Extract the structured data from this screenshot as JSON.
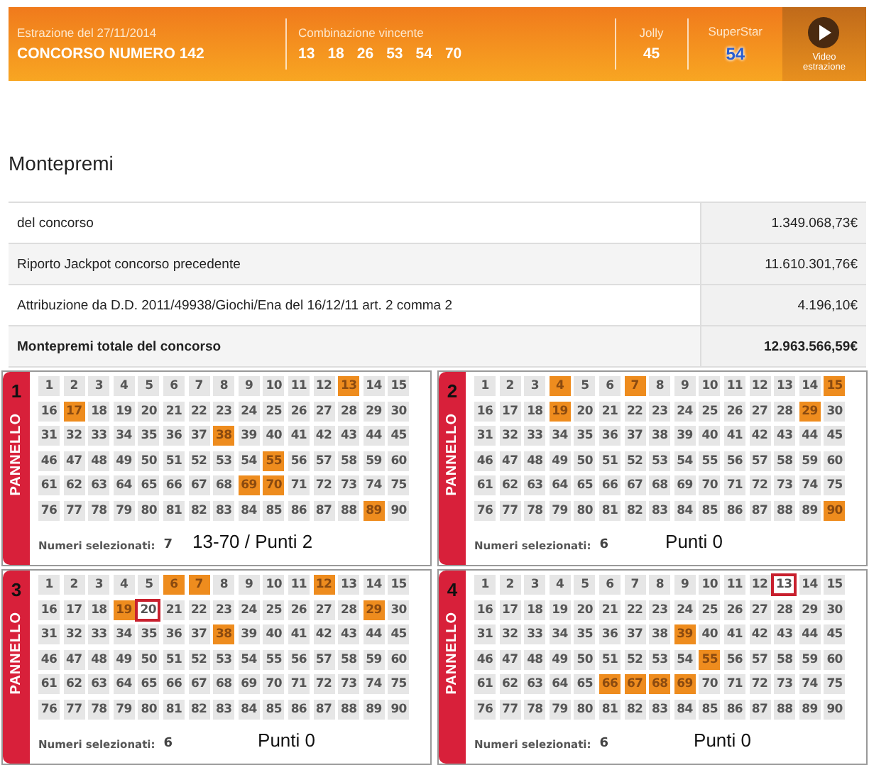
{
  "header": {
    "date_label": "Estrazione del 27/11/2014",
    "title": "CONCORSO NUMERO 142",
    "combination_label": "Combinazione vincente",
    "combination": [
      "13",
      "18",
      "26",
      "53",
      "54",
      "70"
    ],
    "jolly_label": "Jolly",
    "jolly": "45",
    "superstar_label": "SuperStar",
    "superstar": "54",
    "video_label": "Video estrazione"
  },
  "montepremi": {
    "title": "Montepremi",
    "rows": [
      {
        "label": "del concorso",
        "value": "1.349.068,73€",
        "kind": "normal"
      },
      {
        "label": "Riporto Jackpot concorso precedente",
        "value": "11.610.301,76€",
        "kind": "normal"
      },
      {
        "label": "Attribuzione da D.D. 2011/49938/Giochi/Ena del 16/12/11 art. 2 comma 2",
        "value": "4.196,10€",
        "kind": "normal"
      },
      {
        "label": "Montepremi totale del concorso",
        "value": "12.963.566,59€",
        "kind": "total"
      }
    ]
  },
  "panels": [
    {
      "number": "1",
      "label": "PANNELLO",
      "selected_label": "Numeri selezionati:",
      "selected_count": "7",
      "note": "13-70 / Punti 2",
      "cells": [
        {
          "n": "1",
          "kind": "plain"
        },
        {
          "n": "2",
          "kind": "plain"
        },
        {
          "n": "3",
          "kind": "plain"
        },
        {
          "n": "4",
          "kind": "plain"
        },
        {
          "n": "5",
          "kind": "plain"
        },
        {
          "n": "6",
          "kind": "plain"
        },
        {
          "n": "7",
          "kind": "plain"
        },
        {
          "n": "8",
          "kind": "plain"
        },
        {
          "n": "9",
          "kind": "plain"
        },
        {
          "n": "10",
          "kind": "plain"
        },
        {
          "n": "11",
          "kind": "plain"
        },
        {
          "n": "12",
          "kind": "plain"
        },
        {
          "n": "13",
          "kind": "hit"
        },
        {
          "n": "14",
          "kind": "plain"
        },
        {
          "n": "15",
          "kind": "plain"
        },
        {
          "n": "16",
          "kind": "plain"
        },
        {
          "n": "17",
          "kind": "hit"
        },
        {
          "n": "18",
          "kind": "plain"
        },
        {
          "n": "19",
          "kind": "plain"
        },
        {
          "n": "20",
          "kind": "plain"
        },
        {
          "n": "21",
          "kind": "plain"
        },
        {
          "n": "22",
          "kind": "plain"
        },
        {
          "n": "23",
          "kind": "plain"
        },
        {
          "n": "24",
          "kind": "plain"
        },
        {
          "n": "25",
          "kind": "plain"
        },
        {
          "n": "26",
          "kind": "plain"
        },
        {
          "n": "27",
          "kind": "plain"
        },
        {
          "n": "28",
          "kind": "plain"
        },
        {
          "n": "29",
          "kind": "plain"
        },
        {
          "n": "30",
          "kind": "plain"
        },
        {
          "n": "31",
          "kind": "plain"
        },
        {
          "n": "32",
          "kind": "plain"
        },
        {
          "n": "33",
          "kind": "plain"
        },
        {
          "n": "34",
          "kind": "plain"
        },
        {
          "n": "35",
          "kind": "plain"
        },
        {
          "n": "36",
          "kind": "plain"
        },
        {
          "n": "37",
          "kind": "plain"
        },
        {
          "n": "38",
          "kind": "hit"
        },
        {
          "n": "39",
          "kind": "plain"
        },
        {
          "n": "40",
          "kind": "plain"
        },
        {
          "n": "41",
          "kind": "plain"
        },
        {
          "n": "42",
          "kind": "plain"
        },
        {
          "n": "43",
          "kind": "plain"
        },
        {
          "n": "44",
          "kind": "plain"
        },
        {
          "n": "45",
          "kind": "plain"
        },
        {
          "n": "46",
          "kind": "plain"
        },
        {
          "n": "47",
          "kind": "plain"
        },
        {
          "n": "48",
          "kind": "plain"
        },
        {
          "n": "49",
          "kind": "plain"
        },
        {
          "n": "50",
          "kind": "plain"
        },
        {
          "n": "51",
          "kind": "plain"
        },
        {
          "n": "52",
          "kind": "plain"
        },
        {
          "n": "53",
          "kind": "plain"
        },
        {
          "n": "54",
          "kind": "plain"
        },
        {
          "n": "55",
          "kind": "hit"
        },
        {
          "n": "56",
          "kind": "plain"
        },
        {
          "n": "57",
          "kind": "plain"
        },
        {
          "n": "58",
          "kind": "plain"
        },
        {
          "n": "59",
          "kind": "plain"
        },
        {
          "n": "60",
          "kind": "plain"
        },
        {
          "n": "61",
          "kind": "plain"
        },
        {
          "n": "62",
          "kind": "plain"
        },
        {
          "n": "63",
          "kind": "plain"
        },
        {
          "n": "64",
          "kind": "plain"
        },
        {
          "n": "65",
          "kind": "plain"
        },
        {
          "n": "66",
          "kind": "plain"
        },
        {
          "n": "67",
          "kind": "plain"
        },
        {
          "n": "68",
          "kind": "plain"
        },
        {
          "n": "69",
          "kind": "hit"
        },
        {
          "n": "70",
          "kind": "hit"
        },
        {
          "n": "71",
          "kind": "plain"
        },
        {
          "n": "72",
          "kind": "plain"
        },
        {
          "n": "73",
          "kind": "plain"
        },
        {
          "n": "74",
          "kind": "plain"
        },
        {
          "n": "75",
          "kind": "plain"
        },
        {
          "n": "76",
          "kind": "plain"
        },
        {
          "n": "77",
          "kind": "plain"
        },
        {
          "n": "78",
          "kind": "plain"
        },
        {
          "n": "79",
          "kind": "plain"
        },
        {
          "n": "80",
          "kind": "plain"
        },
        {
          "n": "81",
          "kind": "plain"
        },
        {
          "n": "82",
          "kind": "plain"
        },
        {
          "n": "83",
          "kind": "plain"
        },
        {
          "n": "84",
          "kind": "plain"
        },
        {
          "n": "85",
          "kind": "plain"
        },
        {
          "n": "86",
          "kind": "plain"
        },
        {
          "n": "87",
          "kind": "plain"
        },
        {
          "n": "88",
          "kind": "plain"
        },
        {
          "n": "89",
          "kind": "hit"
        },
        {
          "n": "90",
          "kind": "plain"
        }
      ]
    },
    {
      "number": "2",
      "label": "PANNELLO",
      "selected_label": "Numeri selezionati:",
      "selected_count": "6",
      "note": "Punti 0",
      "cells": [
        {
          "n": "1",
          "kind": "plain"
        },
        {
          "n": "2",
          "kind": "plain"
        },
        {
          "n": "3",
          "kind": "plain"
        },
        {
          "n": "4",
          "kind": "hit"
        },
        {
          "n": "5",
          "kind": "plain"
        },
        {
          "n": "6",
          "kind": "plain"
        },
        {
          "n": "7",
          "kind": "hit"
        },
        {
          "n": "8",
          "kind": "plain"
        },
        {
          "n": "9",
          "kind": "plain"
        },
        {
          "n": "10",
          "kind": "plain"
        },
        {
          "n": "11",
          "kind": "plain"
        },
        {
          "n": "12",
          "kind": "plain"
        },
        {
          "n": "13",
          "kind": "plain"
        },
        {
          "n": "14",
          "kind": "plain"
        },
        {
          "n": "15",
          "kind": "hit"
        },
        {
          "n": "16",
          "kind": "plain"
        },
        {
          "n": "17",
          "kind": "plain"
        },
        {
          "n": "18",
          "kind": "plain"
        },
        {
          "n": "19",
          "kind": "hit"
        },
        {
          "n": "20",
          "kind": "plain"
        },
        {
          "n": "21",
          "kind": "plain"
        },
        {
          "n": "22",
          "kind": "plain"
        },
        {
          "n": "23",
          "kind": "plain"
        },
        {
          "n": "24",
          "kind": "plain"
        },
        {
          "n": "25",
          "kind": "plain"
        },
        {
          "n": "26",
          "kind": "plain"
        },
        {
          "n": "27",
          "kind": "plain"
        },
        {
          "n": "28",
          "kind": "plain"
        },
        {
          "n": "29",
          "kind": "hit"
        },
        {
          "n": "30",
          "kind": "plain"
        },
        {
          "n": "31",
          "kind": "plain"
        },
        {
          "n": "32",
          "kind": "plain"
        },
        {
          "n": "33",
          "kind": "plain"
        },
        {
          "n": "34",
          "kind": "plain"
        },
        {
          "n": "35",
          "kind": "plain"
        },
        {
          "n": "36",
          "kind": "plain"
        },
        {
          "n": "37",
          "kind": "plain"
        },
        {
          "n": "38",
          "kind": "plain"
        },
        {
          "n": "39",
          "kind": "plain"
        },
        {
          "n": "40",
          "kind": "plain"
        },
        {
          "n": "41",
          "kind": "plain"
        },
        {
          "n": "42",
          "kind": "plain"
        },
        {
          "n": "43",
          "kind": "plain"
        },
        {
          "n": "44",
          "kind": "plain"
        },
        {
          "n": "45",
          "kind": "plain"
        },
        {
          "n": "46",
          "kind": "plain"
        },
        {
          "n": "47",
          "kind": "plain"
        },
        {
          "n": "48",
          "kind": "plain"
        },
        {
          "n": "49",
          "kind": "plain"
        },
        {
          "n": "50",
          "kind": "plain"
        },
        {
          "n": "51",
          "kind": "plain"
        },
        {
          "n": "52",
          "kind": "plain"
        },
        {
          "n": "53",
          "kind": "plain"
        },
        {
          "n": "54",
          "kind": "plain"
        },
        {
          "n": "55",
          "kind": "plain"
        },
        {
          "n": "56",
          "kind": "plain"
        },
        {
          "n": "57",
          "kind": "plain"
        },
        {
          "n": "58",
          "kind": "plain"
        },
        {
          "n": "59",
          "kind": "plain"
        },
        {
          "n": "60",
          "kind": "plain"
        },
        {
          "n": "61",
          "kind": "plain"
        },
        {
          "n": "62",
          "kind": "plain"
        },
        {
          "n": "63",
          "kind": "plain"
        },
        {
          "n": "64",
          "kind": "plain"
        },
        {
          "n": "65",
          "kind": "plain"
        },
        {
          "n": "66",
          "kind": "plain"
        },
        {
          "n": "67",
          "kind": "plain"
        },
        {
          "n": "68",
          "kind": "plain"
        },
        {
          "n": "69",
          "kind": "plain"
        },
        {
          "n": "70",
          "kind": "plain"
        },
        {
          "n": "71",
          "kind": "plain"
        },
        {
          "n": "72",
          "kind": "plain"
        },
        {
          "n": "73",
          "kind": "plain"
        },
        {
          "n": "74",
          "kind": "plain"
        },
        {
          "n": "75",
          "kind": "plain"
        },
        {
          "n": "76",
          "kind": "plain"
        },
        {
          "n": "77",
          "kind": "plain"
        },
        {
          "n": "78",
          "kind": "plain"
        },
        {
          "n": "79",
          "kind": "plain"
        },
        {
          "n": "80",
          "kind": "plain"
        },
        {
          "n": "81",
          "kind": "plain"
        },
        {
          "n": "82",
          "kind": "plain"
        },
        {
          "n": "83",
          "kind": "plain"
        },
        {
          "n": "84",
          "kind": "plain"
        },
        {
          "n": "85",
          "kind": "plain"
        },
        {
          "n": "86",
          "kind": "plain"
        },
        {
          "n": "87",
          "kind": "plain"
        },
        {
          "n": "88",
          "kind": "plain"
        },
        {
          "n": "89",
          "kind": "plain"
        },
        {
          "n": "90",
          "kind": "hit"
        }
      ]
    },
    {
      "number": "3",
      "label": "PANNELLO",
      "selected_label": "Numeri selezionati:",
      "selected_count": "6",
      "note": "Punti 0",
      "cells": [
        {
          "n": "1",
          "kind": "plain"
        },
        {
          "n": "2",
          "kind": "plain"
        },
        {
          "n": "3",
          "kind": "plain"
        },
        {
          "n": "4",
          "kind": "plain"
        },
        {
          "n": "5",
          "kind": "plain"
        },
        {
          "n": "6",
          "kind": "hit"
        },
        {
          "n": "7",
          "kind": "hit"
        },
        {
          "n": "8",
          "kind": "plain"
        },
        {
          "n": "9",
          "kind": "plain"
        },
        {
          "n": "10",
          "kind": "plain"
        },
        {
          "n": "11",
          "kind": "plain"
        },
        {
          "n": "12",
          "kind": "hit"
        },
        {
          "n": "13",
          "kind": "plain"
        },
        {
          "n": "14",
          "kind": "plain"
        },
        {
          "n": "15",
          "kind": "plain"
        },
        {
          "n": "16",
          "kind": "plain"
        },
        {
          "n": "17",
          "kind": "plain"
        },
        {
          "n": "18",
          "kind": "plain"
        },
        {
          "n": "19",
          "kind": "hit"
        },
        {
          "n": "20",
          "kind": "boxed"
        },
        {
          "n": "21",
          "kind": "plain"
        },
        {
          "n": "22",
          "kind": "plain"
        },
        {
          "n": "23",
          "kind": "plain"
        },
        {
          "n": "24",
          "kind": "plain"
        },
        {
          "n": "25",
          "kind": "plain"
        },
        {
          "n": "26",
          "kind": "plain"
        },
        {
          "n": "27",
          "kind": "plain"
        },
        {
          "n": "28",
          "kind": "plain"
        },
        {
          "n": "29",
          "kind": "hit"
        },
        {
          "n": "30",
          "kind": "plain"
        },
        {
          "n": "31",
          "kind": "plain"
        },
        {
          "n": "32",
          "kind": "plain"
        },
        {
          "n": "33",
          "kind": "plain"
        },
        {
          "n": "34",
          "kind": "plain"
        },
        {
          "n": "35",
          "kind": "plain"
        },
        {
          "n": "36",
          "kind": "plain"
        },
        {
          "n": "37",
          "kind": "plain"
        },
        {
          "n": "38",
          "kind": "hit"
        },
        {
          "n": "39",
          "kind": "plain"
        },
        {
          "n": "40",
          "kind": "plain"
        },
        {
          "n": "41",
          "kind": "plain"
        },
        {
          "n": "42",
          "kind": "plain"
        },
        {
          "n": "43",
          "kind": "plain"
        },
        {
          "n": "44",
          "kind": "plain"
        },
        {
          "n": "45",
          "kind": "plain"
        },
        {
          "n": "46",
          "kind": "plain"
        },
        {
          "n": "47",
          "kind": "plain"
        },
        {
          "n": "48",
          "kind": "plain"
        },
        {
          "n": "49",
          "kind": "plain"
        },
        {
          "n": "50",
          "kind": "plain"
        },
        {
          "n": "51",
          "kind": "plain"
        },
        {
          "n": "52",
          "kind": "plain"
        },
        {
          "n": "53",
          "kind": "plain"
        },
        {
          "n": "54",
          "kind": "plain"
        },
        {
          "n": "55",
          "kind": "plain"
        },
        {
          "n": "56",
          "kind": "plain"
        },
        {
          "n": "57",
          "kind": "plain"
        },
        {
          "n": "58",
          "kind": "plain"
        },
        {
          "n": "59",
          "kind": "plain"
        },
        {
          "n": "60",
          "kind": "plain"
        },
        {
          "n": "61",
          "kind": "plain"
        },
        {
          "n": "62",
          "kind": "plain"
        },
        {
          "n": "63",
          "kind": "plain"
        },
        {
          "n": "64",
          "kind": "plain"
        },
        {
          "n": "65",
          "kind": "plain"
        },
        {
          "n": "66",
          "kind": "plain"
        },
        {
          "n": "67",
          "kind": "plain"
        },
        {
          "n": "68",
          "kind": "plain"
        },
        {
          "n": "69",
          "kind": "plain"
        },
        {
          "n": "70",
          "kind": "plain"
        },
        {
          "n": "71",
          "kind": "plain"
        },
        {
          "n": "72",
          "kind": "plain"
        },
        {
          "n": "73",
          "kind": "plain"
        },
        {
          "n": "74",
          "kind": "plain"
        },
        {
          "n": "75",
          "kind": "plain"
        },
        {
          "n": "76",
          "kind": "plain"
        },
        {
          "n": "77",
          "kind": "plain"
        },
        {
          "n": "78",
          "kind": "plain"
        },
        {
          "n": "79",
          "kind": "plain"
        },
        {
          "n": "80",
          "kind": "plain"
        },
        {
          "n": "81",
          "kind": "plain"
        },
        {
          "n": "82",
          "kind": "plain"
        },
        {
          "n": "83",
          "kind": "plain"
        },
        {
          "n": "84",
          "kind": "plain"
        },
        {
          "n": "85",
          "kind": "plain"
        },
        {
          "n": "86",
          "kind": "plain"
        },
        {
          "n": "87",
          "kind": "plain"
        },
        {
          "n": "88",
          "kind": "plain"
        },
        {
          "n": "89",
          "kind": "plain"
        },
        {
          "n": "90",
          "kind": "plain"
        }
      ]
    },
    {
      "number": "4",
      "label": "PANNELLO",
      "selected_label": "Numeri selezionati:",
      "selected_count": "6",
      "note": "Punti 0",
      "cells": [
        {
          "n": "1",
          "kind": "plain"
        },
        {
          "n": "2",
          "kind": "plain"
        },
        {
          "n": "3",
          "kind": "plain"
        },
        {
          "n": "4",
          "kind": "plain"
        },
        {
          "n": "5",
          "kind": "plain"
        },
        {
          "n": "6",
          "kind": "plain"
        },
        {
          "n": "7",
          "kind": "plain"
        },
        {
          "n": "8",
          "kind": "plain"
        },
        {
          "n": "9",
          "kind": "plain"
        },
        {
          "n": "10",
          "kind": "plain"
        },
        {
          "n": "11",
          "kind": "plain"
        },
        {
          "n": "12",
          "kind": "plain"
        },
        {
          "n": "13",
          "kind": "boxed"
        },
        {
          "n": "14",
          "kind": "plain"
        },
        {
          "n": "15",
          "kind": "plain"
        },
        {
          "n": "16",
          "kind": "plain"
        },
        {
          "n": "17",
          "kind": "plain"
        },
        {
          "n": "18",
          "kind": "plain"
        },
        {
          "n": "19",
          "kind": "plain"
        },
        {
          "n": "20",
          "kind": "plain"
        },
        {
          "n": "21",
          "kind": "plain"
        },
        {
          "n": "22",
          "kind": "plain"
        },
        {
          "n": "23",
          "kind": "plain"
        },
        {
          "n": "24",
          "kind": "plain"
        },
        {
          "n": "25",
          "kind": "plain"
        },
        {
          "n": "26",
          "kind": "plain"
        },
        {
          "n": "27",
          "kind": "plain"
        },
        {
          "n": "28",
          "kind": "plain"
        },
        {
          "n": "29",
          "kind": "plain"
        },
        {
          "n": "30",
          "kind": "plain"
        },
        {
          "n": "31",
          "kind": "plain"
        },
        {
          "n": "32",
          "kind": "plain"
        },
        {
          "n": "33",
          "kind": "plain"
        },
        {
          "n": "34",
          "kind": "plain"
        },
        {
          "n": "35",
          "kind": "plain"
        },
        {
          "n": "36",
          "kind": "plain"
        },
        {
          "n": "37",
          "kind": "plain"
        },
        {
          "n": "38",
          "kind": "plain"
        },
        {
          "n": "39",
          "kind": "hit"
        },
        {
          "n": "40",
          "kind": "plain"
        },
        {
          "n": "41",
          "kind": "plain"
        },
        {
          "n": "42",
          "kind": "plain"
        },
        {
          "n": "43",
          "kind": "plain"
        },
        {
          "n": "44",
          "kind": "plain"
        },
        {
          "n": "45",
          "kind": "plain"
        },
        {
          "n": "46",
          "kind": "plain"
        },
        {
          "n": "47",
          "kind": "plain"
        },
        {
          "n": "48",
          "kind": "plain"
        },
        {
          "n": "49",
          "kind": "plain"
        },
        {
          "n": "50",
          "kind": "plain"
        },
        {
          "n": "51",
          "kind": "plain"
        },
        {
          "n": "52",
          "kind": "plain"
        },
        {
          "n": "53",
          "kind": "plain"
        },
        {
          "n": "54",
          "kind": "plain"
        },
        {
          "n": "55",
          "kind": "hit"
        },
        {
          "n": "56",
          "kind": "plain"
        },
        {
          "n": "57",
          "kind": "plain"
        },
        {
          "n": "58",
          "kind": "plain"
        },
        {
          "n": "59",
          "kind": "plain"
        },
        {
          "n": "60",
          "kind": "plain"
        },
        {
          "n": "61",
          "kind": "plain"
        },
        {
          "n": "62",
          "kind": "plain"
        },
        {
          "n": "63",
          "kind": "plain"
        },
        {
          "n": "64",
          "kind": "plain"
        },
        {
          "n": "65",
          "kind": "plain"
        },
        {
          "n": "66",
          "kind": "hit"
        },
        {
          "n": "67",
          "kind": "hit"
        },
        {
          "n": "68",
          "kind": "hit"
        },
        {
          "n": "69",
          "kind": "hit"
        },
        {
          "n": "70",
          "kind": "plain"
        },
        {
          "n": "71",
          "kind": "plain"
        },
        {
          "n": "72",
          "kind": "plain"
        },
        {
          "n": "73",
          "kind": "plain"
        },
        {
          "n": "74",
          "kind": "plain"
        },
        {
          "n": "75",
          "kind": "plain"
        },
        {
          "n": "76",
          "kind": "plain"
        },
        {
          "n": "77",
          "kind": "plain"
        },
        {
          "n": "78",
          "kind": "plain"
        },
        {
          "n": "79",
          "kind": "plain"
        },
        {
          "n": "80",
          "kind": "plain"
        },
        {
          "n": "81",
          "kind": "plain"
        },
        {
          "n": "82",
          "kind": "plain"
        },
        {
          "n": "83",
          "kind": "plain"
        },
        {
          "n": "84",
          "kind": "plain"
        },
        {
          "n": "85",
          "kind": "plain"
        },
        {
          "n": "86",
          "kind": "plain"
        },
        {
          "n": "87",
          "kind": "plain"
        },
        {
          "n": "88",
          "kind": "plain"
        },
        {
          "n": "89",
          "kind": "plain"
        },
        {
          "n": "90",
          "kind": "plain"
        }
      ]
    }
  ]
}
